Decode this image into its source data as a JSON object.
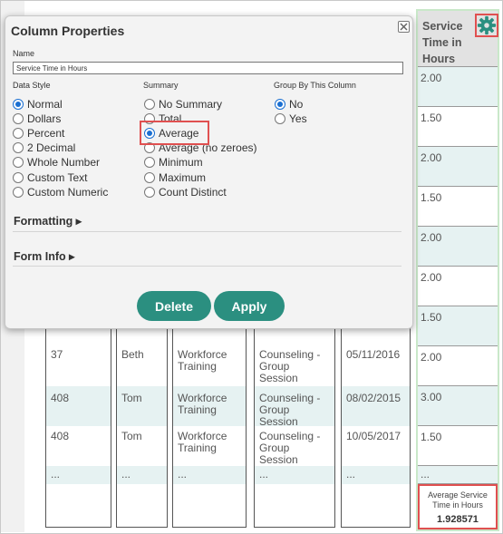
{
  "dialog": {
    "title": "Column Properties",
    "name_label": "Name",
    "name_value": "Service Time in Hours",
    "data_style": {
      "heading": "Data Style",
      "options": [
        "Normal",
        "Dollars",
        "Percent",
        "2 Decimal",
        "Whole Number",
        "Custom Text",
        "Custom Numeric"
      ],
      "selected": "Normal"
    },
    "summary": {
      "heading": "Summary",
      "options": [
        "No Summary",
        "Total",
        "Average",
        "Average (no zeroes)",
        "Minimum",
        "Maximum",
        "Count Distinct"
      ],
      "selected": "Average"
    },
    "group_by": {
      "heading": "Group By This Column",
      "options": [
        "No",
        "Yes"
      ],
      "selected": "No"
    },
    "sections": {
      "formatting": "Formatting ▸",
      "form_info": "Form Info ▸"
    },
    "buttons": {
      "delete": "Delete",
      "apply": "Apply"
    }
  },
  "service_column": {
    "header": "Service Time in Hours",
    "values": [
      "2.00",
      "1.50",
      "2.00",
      "1.50",
      "2.00",
      "2.00",
      "1.50",
      "2.00",
      "3.00",
      "1.50",
      "..."
    ],
    "footer_label": "Average Service Time in Hours",
    "footer_value": "1.928571"
  },
  "table_rows": [
    {
      "id": "37",
      "name": "Beth",
      "program": "Workforce Training",
      "service": "Counseling - Group Session",
      "date": "05/11/2016"
    },
    {
      "id": "408",
      "name": "Tom",
      "program": "Workforce Training",
      "service": "Counseling - Group Session",
      "date": "08/02/2015"
    },
    {
      "id": "408",
      "name": "Tom",
      "program": "Workforce Training",
      "service": "Counseling - Group Session",
      "date": "10/05/2017"
    },
    {
      "id": "...",
      "name": "...",
      "program": "...",
      "service": "...",
      "date": "..."
    }
  ],
  "colors": {
    "accent": "#2b8f80",
    "highlight": "#e05050",
    "radio": "#1a6fd1",
    "row_shade": "#e6f2f2"
  }
}
